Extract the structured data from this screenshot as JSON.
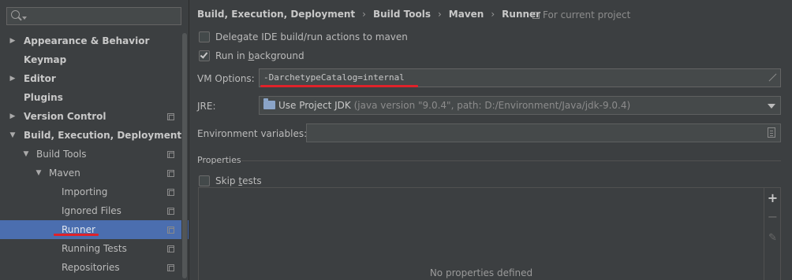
{
  "sidebar": {
    "search": {
      "value": "",
      "placeholder": ""
    },
    "items": [
      {
        "label": "Appearance & Behavior",
        "expanded": false,
        "bold": true,
        "level": 0,
        "has_project_icon": false
      },
      {
        "label": "Keymap",
        "bold": true,
        "level": 0,
        "has_project_icon": false
      },
      {
        "label": "Editor",
        "expanded": false,
        "bold": true,
        "level": 0,
        "has_project_icon": false
      },
      {
        "label": "Plugins",
        "bold": true,
        "level": 0,
        "has_project_icon": false
      },
      {
        "label": "Version Control",
        "expanded": false,
        "bold": true,
        "level": 0,
        "has_project_icon": true
      },
      {
        "label": "Build, Execution, Deployment",
        "expanded": true,
        "bold": true,
        "level": 0,
        "has_project_icon": false
      },
      {
        "label": "Build Tools",
        "expanded": true,
        "bold": false,
        "level": 1,
        "has_project_icon": true
      },
      {
        "label": "Maven",
        "expanded": true,
        "bold": false,
        "level": 2,
        "has_project_icon": true
      },
      {
        "label": "Importing",
        "bold": false,
        "level": 3,
        "has_project_icon": true
      },
      {
        "label": "Ignored Files",
        "bold": false,
        "level": 3,
        "has_project_icon": true
      },
      {
        "label": "Runner",
        "bold": false,
        "level": 3,
        "has_project_icon": true,
        "selected": true
      },
      {
        "label": "Running Tests",
        "bold": false,
        "level": 3,
        "has_project_icon": true
      },
      {
        "label": "Repositories",
        "bold": false,
        "level": 3,
        "has_project_icon": true
      }
    ]
  },
  "breadcrumb": [
    "Build, Execution, Deployment",
    "Build Tools",
    "Maven",
    "Runner"
  ],
  "scope_label": "For current project",
  "options": {
    "delegate": {
      "label": "Delegate IDE build/run actions to maven",
      "checked": false
    },
    "background": {
      "label_before": "Run in ",
      "label_mnemonic": "b",
      "label_after": "ackground",
      "checked": true
    }
  },
  "vm_options": {
    "label": "VM Options:",
    "value": "-DarchetypeCatalog=internal"
  },
  "jre": {
    "label": "JRE:",
    "selected": "Use Project JDK",
    "detail": "(java version \"9.0.4\", path: D:/Environment/Java/jdk-9.0.4)"
  },
  "env_vars": {
    "label": "Environment variables:",
    "value": ""
  },
  "properties": {
    "title": "Properties",
    "skip_tests": {
      "label_before": "Skip ",
      "label_mnemonic": "t",
      "label_after": "ests",
      "checked": false
    },
    "empty_text": "No properties defined"
  },
  "colors": {
    "background": "#3c3f41",
    "selection": "#4b6eaf",
    "annotation_red": "#e0222a"
  }
}
